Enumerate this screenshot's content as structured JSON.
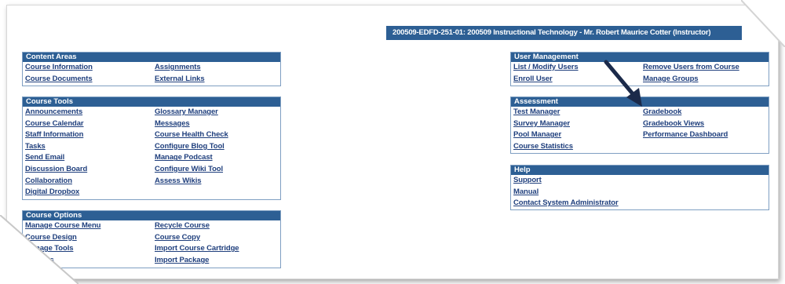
{
  "header": {
    "course_title": "200509-EDFD-251-01: 200509 Instructional Technology - Mr. Robert Maurice Cotter (Instructor)"
  },
  "content_areas": {
    "title": "Content Areas",
    "left": [
      "Course Information",
      "Course Documents"
    ],
    "right": [
      "Assignments",
      "External Links"
    ]
  },
  "course_tools": {
    "title": "Course Tools",
    "left": [
      "Announcements",
      "Course Calendar",
      "Staff Information",
      "Tasks",
      "Send Email",
      "Discussion Board",
      "Collaboration",
      "Digital Dropbox"
    ],
    "right": [
      "Glossary Manager",
      "Messages",
      "Course Health Check",
      "Configure Blog Tool",
      "Manage Podcast",
      "Configure Wiki Tool",
      "Assess Wikis"
    ]
  },
  "course_options": {
    "title": "Course Options",
    "left": [
      "Manage Course Menu",
      "Course Design",
      "Manage Tools",
      "Settings"
    ],
    "right": [
      "Recycle Course",
      "Course Copy",
      "Import Course Cartridge",
      "Import Package"
    ]
  },
  "user_management": {
    "title": "User Management",
    "left": [
      "List / Modify Users",
      "Enroll User"
    ],
    "right": [
      "Remove Users from Course",
      "Manage Groups"
    ]
  },
  "assessment": {
    "title": "Assessment",
    "left": [
      "Test Manager",
      "Survey Manager",
      "Pool Manager",
      "Course Statistics"
    ],
    "right": [
      "Gradebook",
      "Gradebook Views",
      "Performance Dashboard"
    ]
  },
  "help": {
    "title": "Help",
    "left": [
      "Support",
      "Manual",
      "Contact System Administrator"
    ],
    "right": []
  },
  "colors": {
    "header_blue": "#2d5f94",
    "link_blue": "#1f3f7d",
    "arrow": "#1b2a4a"
  }
}
